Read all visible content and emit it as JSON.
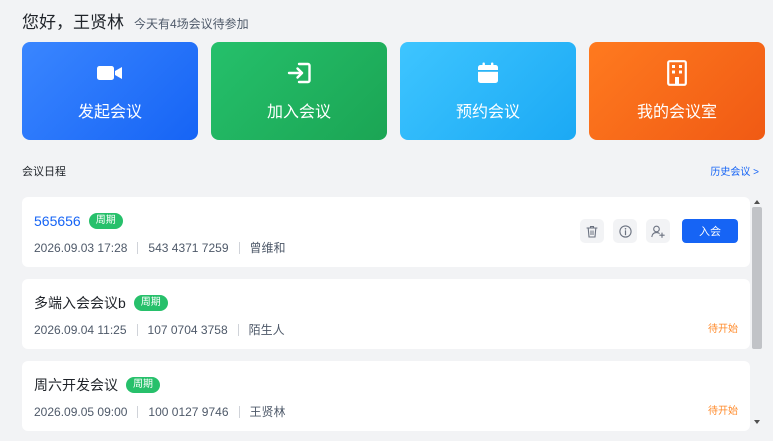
{
  "header": {
    "greeting": "您好，王贤林",
    "subtitle": "今天有4场会议待参加"
  },
  "actions": [
    {
      "label": "发起会议",
      "icon": "video-camera-icon",
      "color": "#1664f5"
    },
    {
      "label": "加入会议",
      "icon": "enter-icon",
      "color": "#1ba554"
    },
    {
      "label": "预约会议",
      "icon": "calendar-icon",
      "color": "#1ba9f4"
    },
    {
      "label": "我的会议室",
      "icon": "building-icon",
      "color": "#f05a14"
    }
  ],
  "schedule": {
    "title": "会议日程",
    "history_link": "历史会议 >"
  },
  "meetings": [
    {
      "name": "565656",
      "badge": "周期",
      "datetime": "2026.09.03 17:28",
      "meeting_id": "543 4371 7259",
      "host": "曾维和",
      "join_label": "入会"
    },
    {
      "name": "多端入会会议b",
      "badge": "周期",
      "datetime": "2026.09.04 11:25",
      "meeting_id": "107 0704 3758",
      "host": "陌生人",
      "status": "待开始"
    },
    {
      "name": "周六开发会议",
      "badge": "周期",
      "datetime": "2026.09.05 09:00",
      "meeting_id": "100 0127 9746",
      "host": "王贤林",
      "status": "待开始"
    }
  ],
  "colors": {
    "accent": "#1664f5",
    "badge": "#27c06b",
    "pending": "#ff8b2c"
  }
}
